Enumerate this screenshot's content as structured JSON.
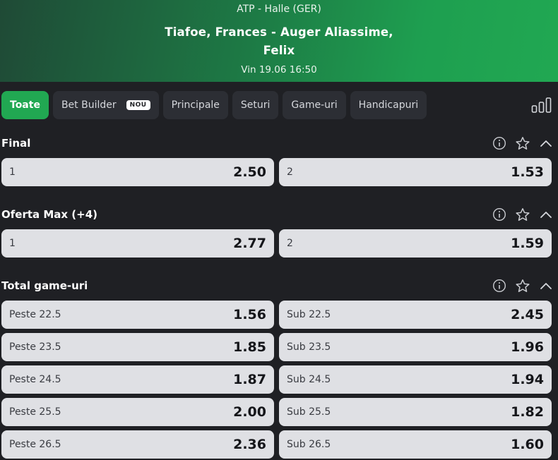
{
  "header": {
    "league": "ATP - Halle (GER)",
    "match_line1": "Tiafoe, Frances - Auger Aliassime,",
    "match_line2": "Felix",
    "datetime": "Vin 19.06 16:50"
  },
  "tabs": [
    {
      "label": "Toate",
      "active": true
    },
    {
      "label": "Bet Builder",
      "badge": "NOU"
    },
    {
      "label": "Principale"
    },
    {
      "label": "Seturi"
    },
    {
      "label": "Game-uri"
    },
    {
      "label": "Handicapuri"
    }
  ],
  "sections": [
    {
      "title": "Final",
      "rows": [
        {
          "left_label": "1",
          "left_odd": "2.50",
          "right_label": "2",
          "right_odd": "1.53"
        }
      ]
    },
    {
      "title": "Oferta Max (+4)",
      "rows": [
        {
          "left_label": "1",
          "left_odd": "2.77",
          "right_label": "2",
          "right_odd": "1.59"
        }
      ]
    },
    {
      "title": "Total game-uri",
      "rows": [
        {
          "left_label": "Peste 22.5",
          "left_odd": "1.56",
          "right_label": "Sub 22.5",
          "right_odd": "2.45"
        },
        {
          "left_label": "Peste 23.5",
          "left_odd": "1.85",
          "right_label": "Sub 23.5",
          "right_odd": "1.96"
        },
        {
          "left_label": "Peste 24.5",
          "left_odd": "1.87",
          "right_label": "Sub 24.5",
          "right_odd": "1.94"
        },
        {
          "left_label": "Peste 25.5",
          "left_odd": "2.00",
          "right_label": "Sub 25.5",
          "right_odd": "1.82"
        },
        {
          "left_label": "Peste 26.5",
          "left_odd": "2.36",
          "right_label": "Sub 26.5",
          "right_odd": "1.60"
        }
      ]
    }
  ],
  "icons": {
    "stats": "bar-chart-icon",
    "info": "info-icon",
    "favorite": "star-icon",
    "collapse": "chevron-up-icon"
  },
  "colors": {
    "accent": "#21a852",
    "background": "#1f2024",
    "tab_bg": "#2c2e34",
    "cell_bg": "#dfe0e4"
  }
}
